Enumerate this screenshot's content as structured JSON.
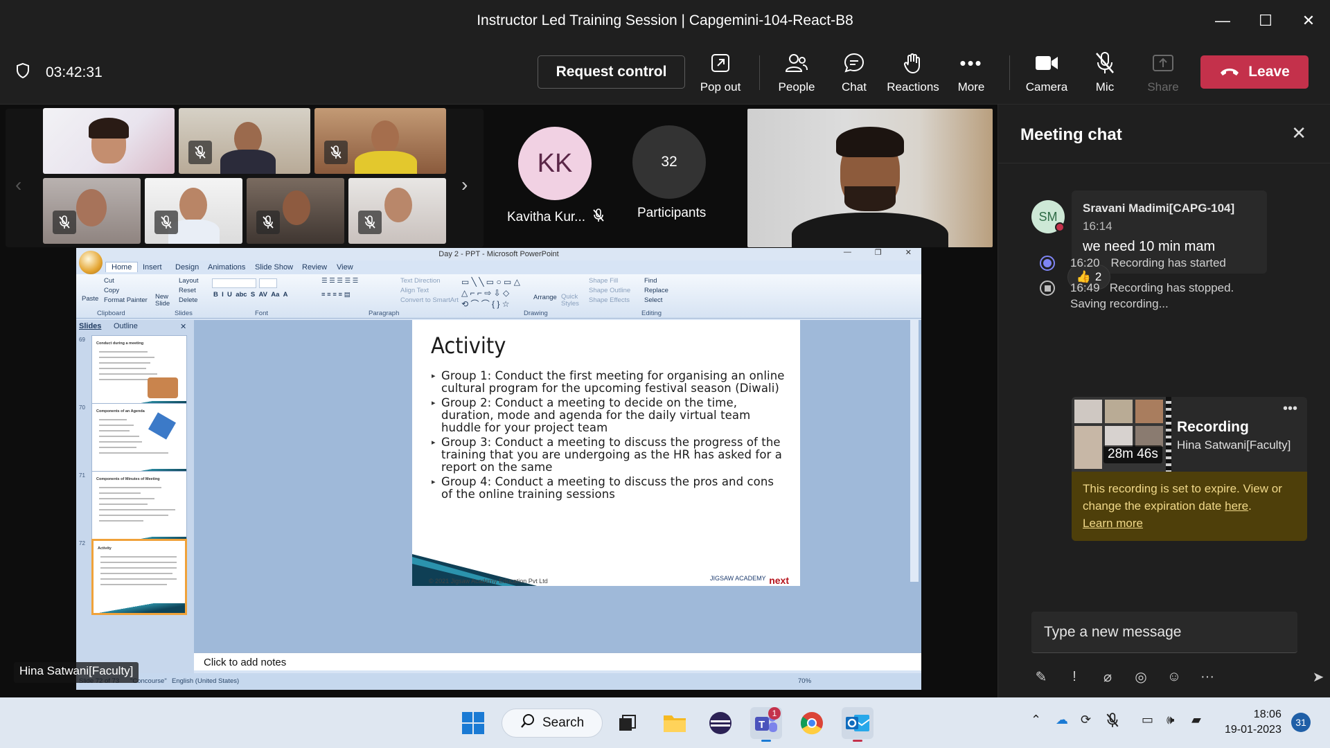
{
  "window": {
    "title": "Instructor Led Training Session | Capgemini-104-React-B8",
    "minimize": "—",
    "maximize": "☐",
    "close": "✕"
  },
  "toolbar": {
    "timer": "03:42:31",
    "request_control": "Request control",
    "popout": "Pop out",
    "people": "People",
    "chat": "Chat",
    "reactions": "Reactions",
    "more": "More",
    "camera": "Camera",
    "mic": "Mic",
    "share": "Share",
    "leave": "Leave"
  },
  "gallery": {
    "kk_initials": "KK",
    "kk_name": "Kavitha Kur...",
    "participants_count": "32",
    "participants_label": "Participants",
    "presenter_tag": "Hina Satwani[Faculty]"
  },
  "ppt": {
    "title": "Day 2 - PPT - Microsoft PowerPoint",
    "tabs": [
      "Home",
      "Insert",
      "Design",
      "Animations",
      "Slide Show",
      "Review",
      "View"
    ],
    "ribbon": {
      "cut": "Cut",
      "copy": "Copy",
      "format_painter": "Format Painter",
      "paste": "Paste",
      "layout": "Layout",
      "reset": "Reset",
      "delete": "Delete",
      "new_slide": "New Slide",
      "text_direction": "Text Direction",
      "align_text": "Align Text",
      "convert_smartart": "Convert to SmartArt",
      "arrange": "Arrange",
      "quick_styles": "Quick Styles",
      "shape_fill": "Shape Fill",
      "shape_outline": "Shape Outline",
      "shape_effects": "Shape Effects",
      "find": "Find",
      "replace": "Replace",
      "select": "Select",
      "groups": {
        "clipboard": "Clipboard",
        "slides": "Slides",
        "font": "Font",
        "paragraph": "Paragraph",
        "drawing": "Drawing",
        "editing": "Editing"
      }
    },
    "pane_tabs": {
      "slides": "Slides",
      "outline": "Outline"
    },
    "thumbs": [
      {
        "num": "69",
        "title": "Conduct during a meeting"
      },
      {
        "num": "70",
        "title": "Components of an Agenda"
      },
      {
        "num": "71",
        "title": "Components of Minutes of Meeting"
      },
      {
        "num": "72",
        "title": "Activity"
      }
    ],
    "slide": {
      "heading": "Activity",
      "bullets": [
        "Group 1: Conduct the first meeting for organising an online cultural program for the upcoming festival season (Diwali)",
        "Group 2: Conduct a meeting to decide on the time, duration, mode and agenda for the daily virtual team huddle for your project team",
        "Group 3: Conduct a meeting to discuss the progress of the training that you are undergoing as the HR has asked for a report on the same",
        "Group 4: Conduct a meeting to discuss the pros and cons of the online training sessions"
      ],
      "copyright": "© 2021 Jigsaw Academy Education Pvt Ltd",
      "jigsaw": "JIGSAW ACADEMY",
      "next": "next"
    },
    "notes": "Click to add notes",
    "status": {
      "slide": "Slide 72 of 73",
      "theme": "\"Concourse\"",
      "language": "English (United States)",
      "zoom": "70%"
    }
  },
  "chat": {
    "title": "Meeting chat",
    "message": {
      "initials": "SM",
      "author": "Sravani Madimi[CAPG-104]",
      "time": "16:14",
      "text": "we need 10 min mam",
      "reaction_emoji": "👍",
      "reaction_count": "2"
    },
    "events": [
      {
        "time": "16:20",
        "text": "Recording has started"
      },
      {
        "time": "16:49",
        "text": "Recording has stopped. Saving recording..."
      }
    ],
    "recording": {
      "title": "Recording",
      "owner": "Hina Satwani[Faculty]",
      "duration": "28m 46s",
      "warning_prefix": "This recording is set to expire. View or change the expiration date ",
      "here": "here",
      "warning_suffix": ".",
      "learn_more": "Learn more"
    },
    "compose_placeholder": "Type a new message"
  },
  "taskbar": {
    "search": "Search",
    "teams_badge": "1",
    "time": "18:06",
    "date": "19-01-2023",
    "notifications": "31"
  }
}
